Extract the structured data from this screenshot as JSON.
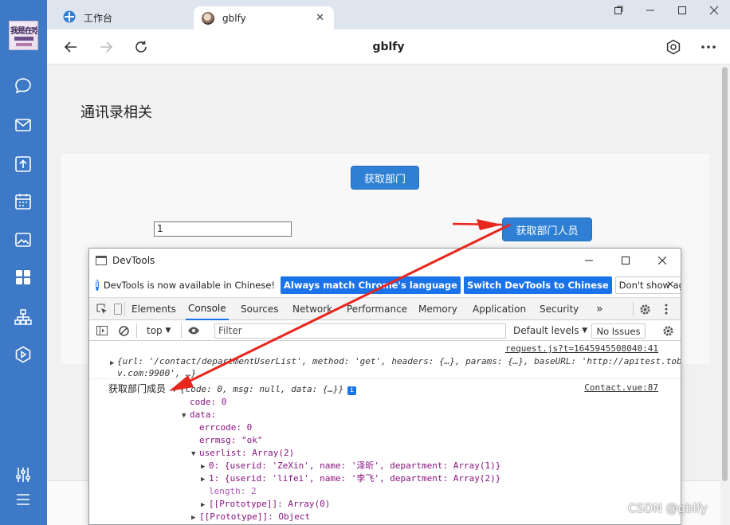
{
  "rail": {
    "items": [
      "chat",
      "mail",
      "upload",
      "calendar",
      "photo",
      "apps",
      "org",
      "play"
    ],
    "bottom": [
      "settings-sliders",
      "menu"
    ],
    "accent": "#3d79c6",
    "logo_text": "我是在吃"
  },
  "tabs": [
    {
      "label": "工作台"
    },
    {
      "label": "gblfy"
    }
  ],
  "navbar": {
    "title": "gblfy"
  },
  "page": {
    "heading": "通讯录相关",
    "get_dept_button": "获取部门",
    "dept_input_value": "1",
    "get_members_button": "获取部门人员"
  },
  "devtools": {
    "title": "DevTools",
    "info_message": "DevTools is now available in Chinese!",
    "info_buttons": [
      "Always match Chrome's language",
      "Switch DevTools to Chinese",
      "Don't show again"
    ],
    "tabs": [
      "Elements",
      "Console",
      "Sources",
      "Network",
      "Performance",
      "Memory",
      "Application",
      "Security"
    ],
    "active_tab": "Console",
    "more": "»",
    "context": "top",
    "filter_placeholder": "Filter",
    "levels": "Default levels",
    "issues": "No Issues",
    "log1": {
      "source": "request.js?t=1645945508040:41",
      "line1": "{url: '/contact/departmentUserList', method: 'get', headers: {…}, params: {…}, baseURL: 'http://apitest.tobde",
      "line2": "v.com:9900', …}"
    },
    "log2": {
      "source": "Contact.vue:87",
      "label": "获取部门成员",
      "summary": "{code: 0, msg: null, data: {…}}",
      "code": "code: 0",
      "data": "data:",
      "errcode": "errcode: 0",
      "errmsg": "errmsg: \"ok\"",
      "userlist": "userlist: Array(2)",
      "u0": "0: {userid: 'ZeXin', name: '泽昕', department: Array(1)}",
      "u1": "1: {userid: 'lifei', name: '李飞', department: Array(2)}",
      "length": "length: 2",
      "proto1": "[[Prototype]]: Array(0)",
      "proto2": "[[Prototype]]: Object"
    }
  },
  "watermark": "CSDN @gblfy",
  "annotation_color": "#e8261e"
}
